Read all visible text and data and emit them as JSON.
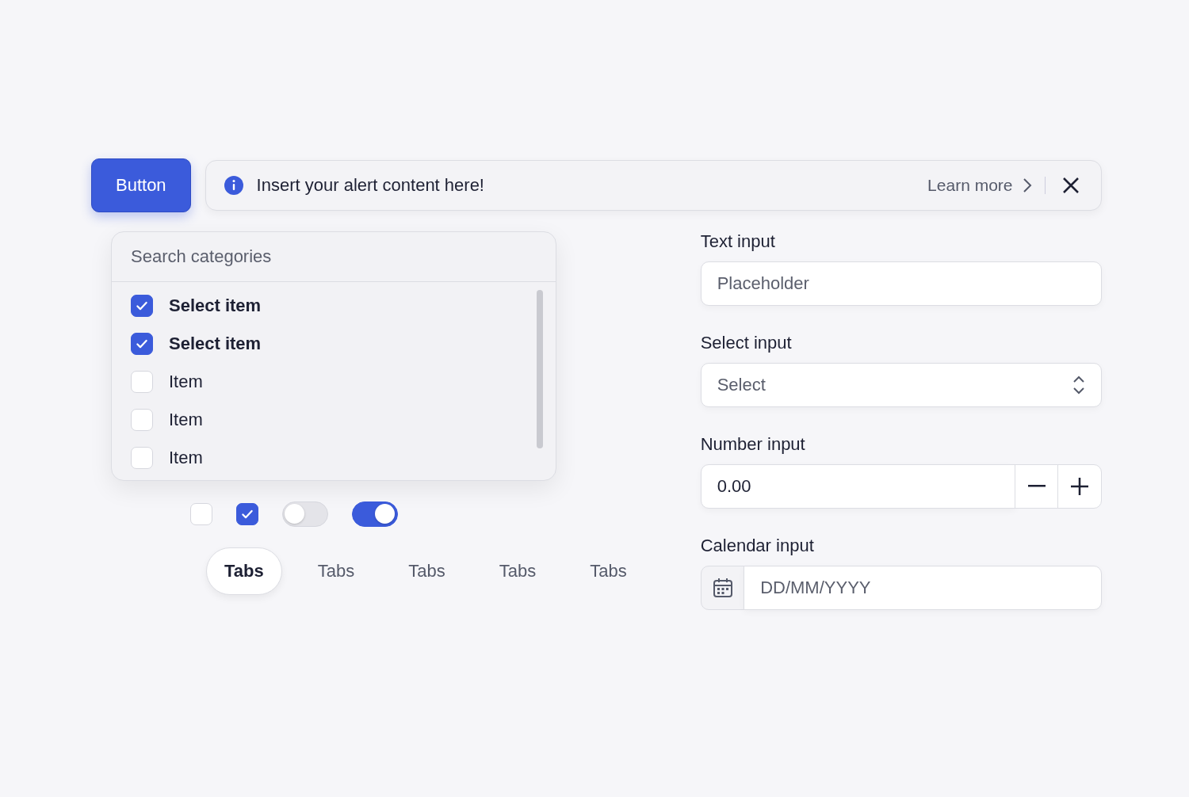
{
  "button": {
    "label": "Button"
  },
  "alert": {
    "message": "Insert your alert content here!",
    "link": "Learn more"
  },
  "dropdown": {
    "search": {
      "placeholder": "Search categories"
    },
    "items": [
      {
        "label": "Select item",
        "checked": true
      },
      {
        "label": "Select item",
        "checked": true
      },
      {
        "label": "Item",
        "checked": false
      },
      {
        "label": "Item",
        "checked": false
      },
      {
        "label": "Item",
        "checked": false
      }
    ]
  },
  "controls": [
    {
      "kind": "checkbox",
      "checked": false
    },
    {
      "kind": "checkbox",
      "checked": true
    },
    {
      "kind": "toggle",
      "on": false
    },
    {
      "kind": "toggle",
      "on": true
    }
  ],
  "tabs": [
    {
      "label": "Tabs",
      "selected": true
    },
    {
      "label": "Tabs",
      "selected": false
    },
    {
      "label": "Tabs",
      "selected": false
    },
    {
      "label": "Tabs",
      "selected": false
    },
    {
      "label": "Tabs",
      "selected": false
    }
  ],
  "form": {
    "text": {
      "label": "Text input",
      "placeholder": "Placeholder"
    },
    "select": {
      "label": "Select input",
      "placeholder": "Select"
    },
    "number": {
      "label": "Number input",
      "value": "0.00"
    },
    "calendar": {
      "label": "Calendar input",
      "placeholder": "DD/MM/YYYY"
    }
  }
}
